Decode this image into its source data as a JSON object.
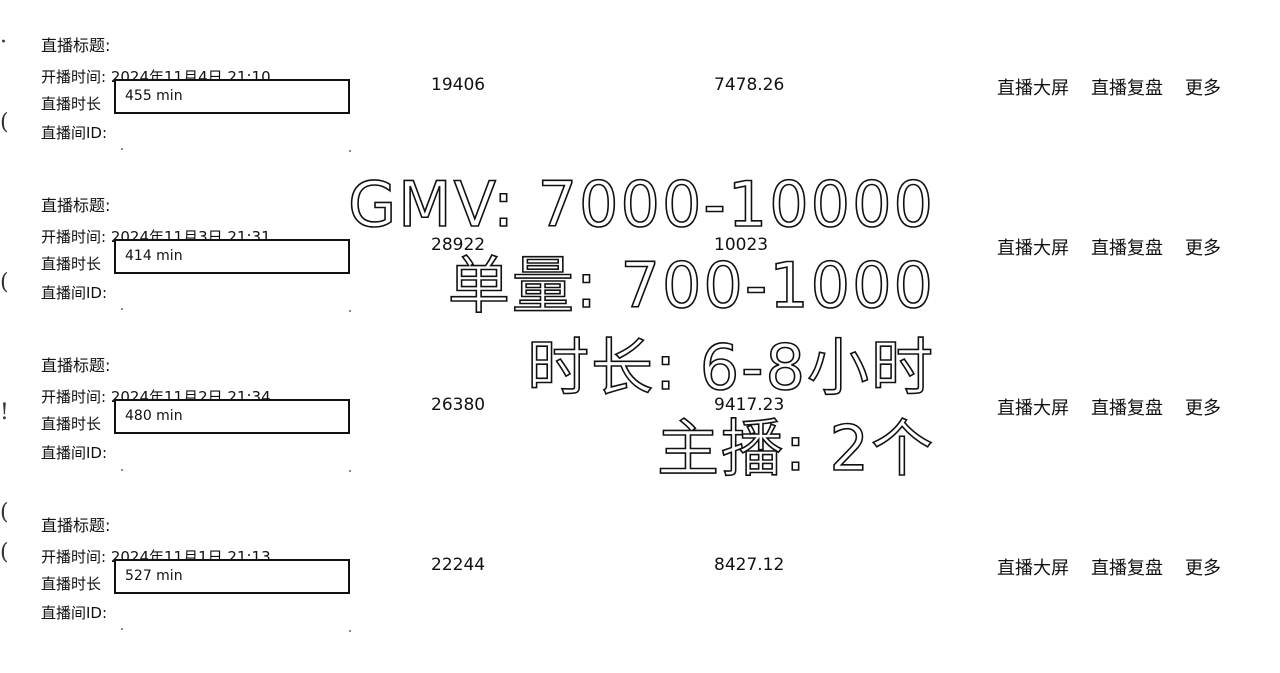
{
  "labels": {
    "title": "直播标题:",
    "start_prefix": "开播时间:",
    "duration": "直播时长",
    "room_id": "直播间ID:"
  },
  "actions": {
    "big_screen": "直播大屏",
    "review": "直播复盘",
    "more": "更多"
  },
  "sessions": [
    {
      "start_time": "2024年11月4日 21:10",
      "duration": "455 min",
      "orders": "19406",
      "gmv": "7478.26"
    },
    {
      "start_time": "2024年11月3日 21:31",
      "duration": "414 min",
      "orders": "28922",
      "gmv": "10023"
    },
    {
      "start_time": "2024年11月2日 21:34",
      "duration": "480 min",
      "orders": "26380",
      "gmv": "9417.23"
    },
    {
      "start_time": "2024年11月1日 21:13",
      "duration": "527 min",
      "orders": "22244",
      "gmv": "8427.12"
    }
  ],
  "overlay": {
    "line1": "GMV: 7000-10000",
    "line2": "单量: 700-1000",
    "line3": "时长: 6-8小时",
    "line4": "主播: 2个"
  }
}
